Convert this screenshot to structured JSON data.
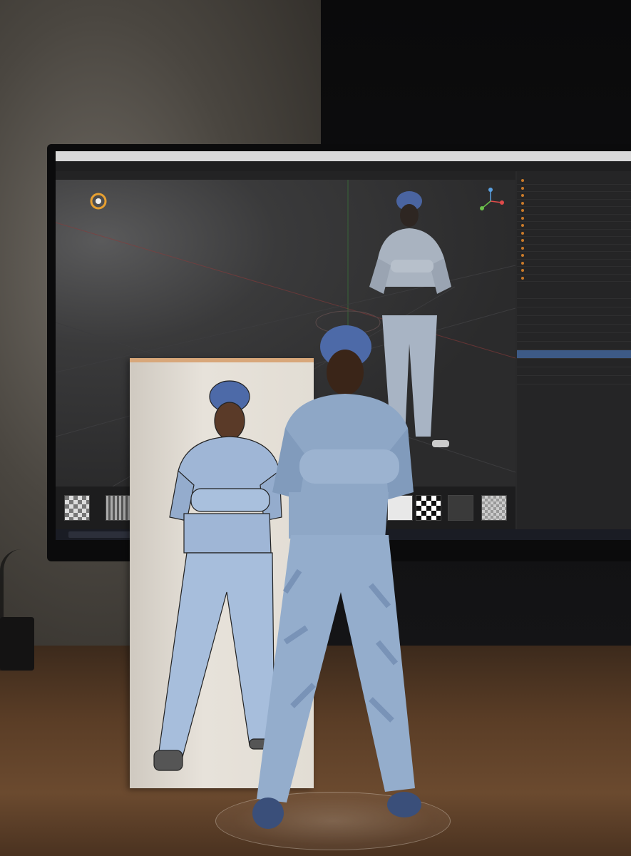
{
  "scene": {
    "description_colors": {
      "wall": "#4a4640",
      "desk": "#5a3d26",
      "beanie": "#4d6aa8",
      "denim": "#8fa8c8",
      "ui_selection": "#3d5a86"
    }
  },
  "monitor": {
    "window_title": "",
    "menu_items": [],
    "viewport_header": "",
    "outliner_rows": [
      "",
      "",
      "",
      "",
      "",
      "",
      "",
      "",
      "",
      "",
      "",
      "",
      "",
      ""
    ],
    "property_rows": [
      "",
      "",
      "",
      "",
      "",
      "",
      "",
      "",
      "",
      "",
      ""
    ],
    "selected_property_index": 7,
    "asset_tabs": [],
    "taskbar_search": "",
    "taskbar_clock": ""
  },
  "icons": [
    "gizmo-axis-icon",
    "sun-light-icon",
    "checkerboard-material-icon",
    "search-icon"
  ]
}
